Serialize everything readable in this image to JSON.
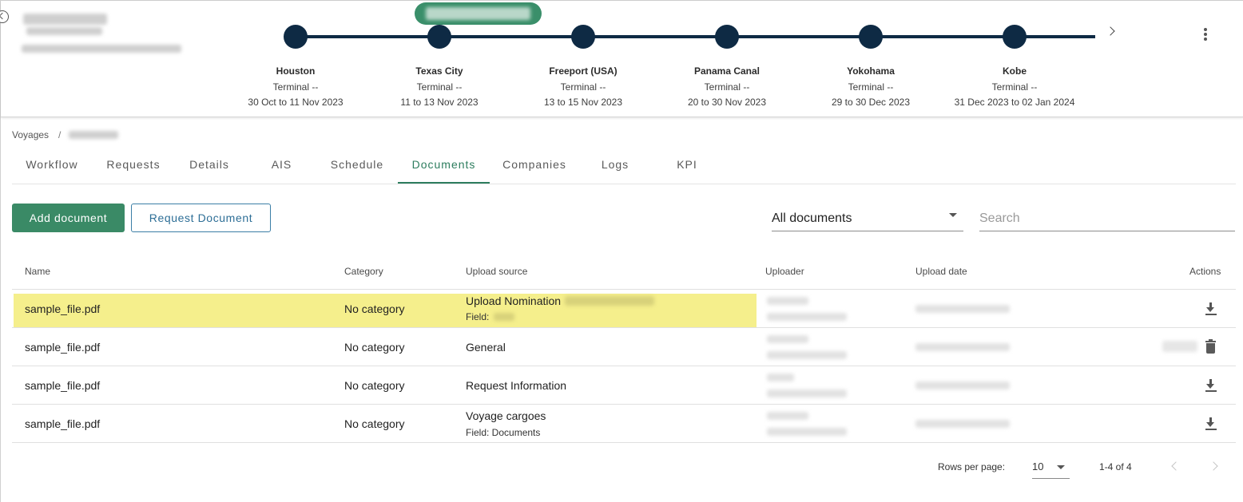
{
  "header": {
    "ports": [
      {
        "name": "Houston",
        "terminal": "Terminal --",
        "dates": "30 Oct to 11 Nov 2023"
      },
      {
        "name": "Texas City",
        "terminal": "Terminal --",
        "dates": "11 to 13 Nov 2023"
      },
      {
        "name": "Freeport (USA)",
        "terminal": "Terminal --",
        "dates": "13 to 15 Nov 2023"
      },
      {
        "name": "Panama Canal",
        "terminal": "Terminal --",
        "dates": "20 to 30 Nov 2023"
      },
      {
        "name": "Yokohama",
        "terminal": "Terminal --",
        "dates": "29 to 30 Dec 2023"
      },
      {
        "name": "Kobe",
        "terminal": "Terminal --",
        "dates": "31 Dec 2023 to 02 Jan 2024"
      }
    ]
  },
  "breadcrumb": {
    "root": "Voyages",
    "separator": "/"
  },
  "tabs": [
    "Workflow",
    "Requests",
    "Details",
    "AIS",
    "Schedule",
    "Documents",
    "Companies",
    "Logs",
    "KPI"
  ],
  "active_tab": "Documents",
  "toolbar": {
    "add_label": "Add document",
    "request_label": "Request Document",
    "filter_value": "All documents",
    "search_placeholder": "Search"
  },
  "table": {
    "headers": {
      "name": "Name",
      "category": "Category",
      "source": "Upload source",
      "uploader": "Uploader",
      "date": "Upload date",
      "actions": "Actions"
    },
    "rows": [
      {
        "name": "sample_file.pdf",
        "category": "No category",
        "source": "Upload Nomination",
        "field": "Field:",
        "action": "download-icon"
      },
      {
        "name": "sample_file.pdf",
        "category": "No category",
        "source": "General",
        "field": "",
        "action": "delete-icon"
      },
      {
        "name": "sample_file.pdf",
        "category": "No category",
        "source": "Request Information",
        "field": "",
        "action": "download-icon"
      },
      {
        "name": "sample_file.pdf",
        "category": "No category",
        "source": "Voyage cargoes",
        "field": "Field: Documents",
        "action": "download-icon"
      }
    ]
  },
  "pagination": {
    "rows_label": "Rows per page:",
    "rows_value": "10",
    "range": "1-4 of 4"
  },
  "colors": {
    "accent": "#3a8a66",
    "timeline": "#0e2a44",
    "highlight": "#f5ef8c",
    "link": "#2d6e96"
  }
}
